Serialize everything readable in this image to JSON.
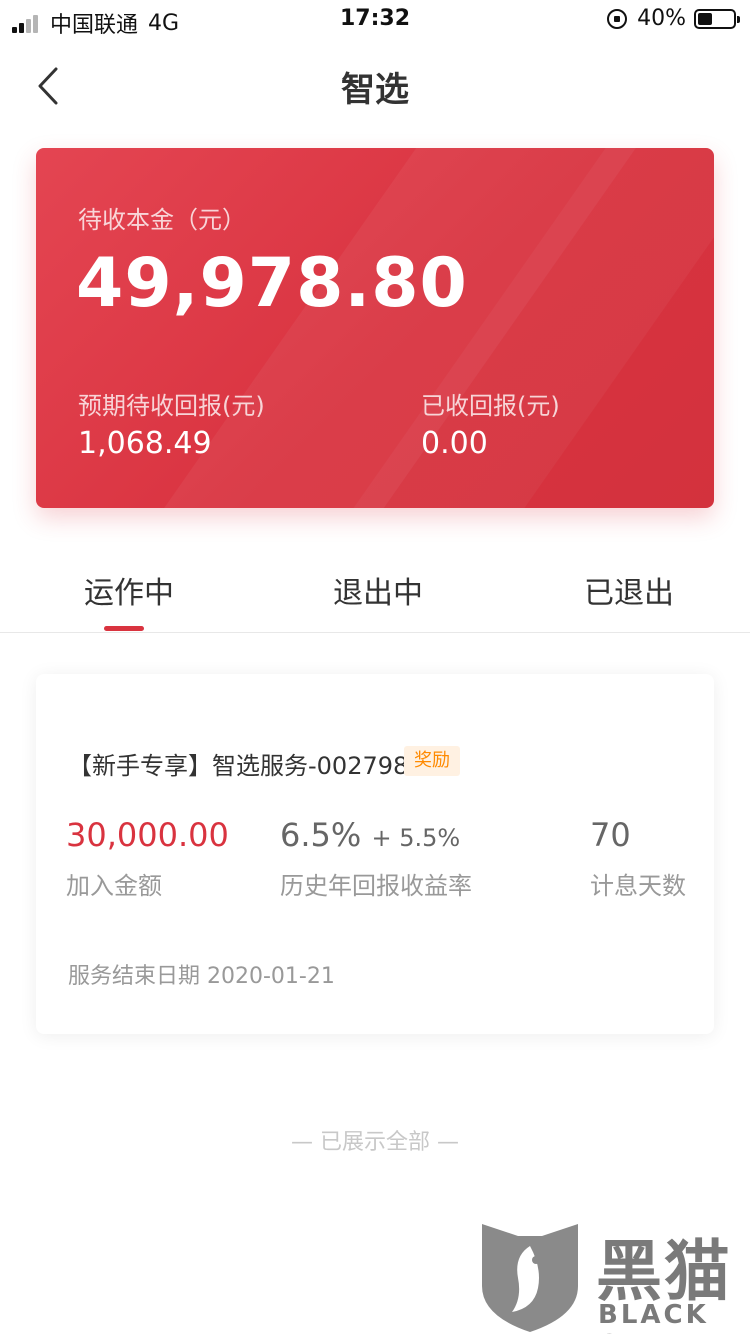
{
  "status_bar": {
    "carrier": "中国联通",
    "network": "4G",
    "time": "17:32",
    "battery": "40%"
  },
  "nav": {
    "title": "智选",
    "back_icon": "chevron-left-icon"
  },
  "summary": {
    "principal_label": "待收本金（元）",
    "principal_value": "49,978.80",
    "expected_label": "预期待收回报(元)",
    "expected_value": "1,068.49",
    "received_label": "已收回报(元)",
    "received_value": "0.00",
    "colors": {
      "card_start": "#e44552",
      "card_end": "#d3323d"
    }
  },
  "tabs": [
    {
      "label": "运作中",
      "active": true
    },
    {
      "label": "退出中",
      "active": false
    },
    {
      "label": "已退出",
      "active": false
    }
  ],
  "product": {
    "title": "【新手专享】智选服务-002798",
    "badge": "奖励",
    "amount_value": "30,000.00",
    "amount_label": "加入金额",
    "rate_base": "6.5%",
    "rate_plus": "+ 5.5%",
    "rate_label": "历史年回报收益率",
    "days_value": "70",
    "days_label": "计息天数",
    "end_date": "服务结束日期 2020-01-21",
    "colors": {
      "accent": "#d9333f",
      "badge_bg": "#fff1e2",
      "badge_text": "#ff8a00"
    }
  },
  "end_note": "— 已展示全部 —",
  "watermark": {
    "text": "黑猫",
    "sub": "BLACK CAT"
  }
}
